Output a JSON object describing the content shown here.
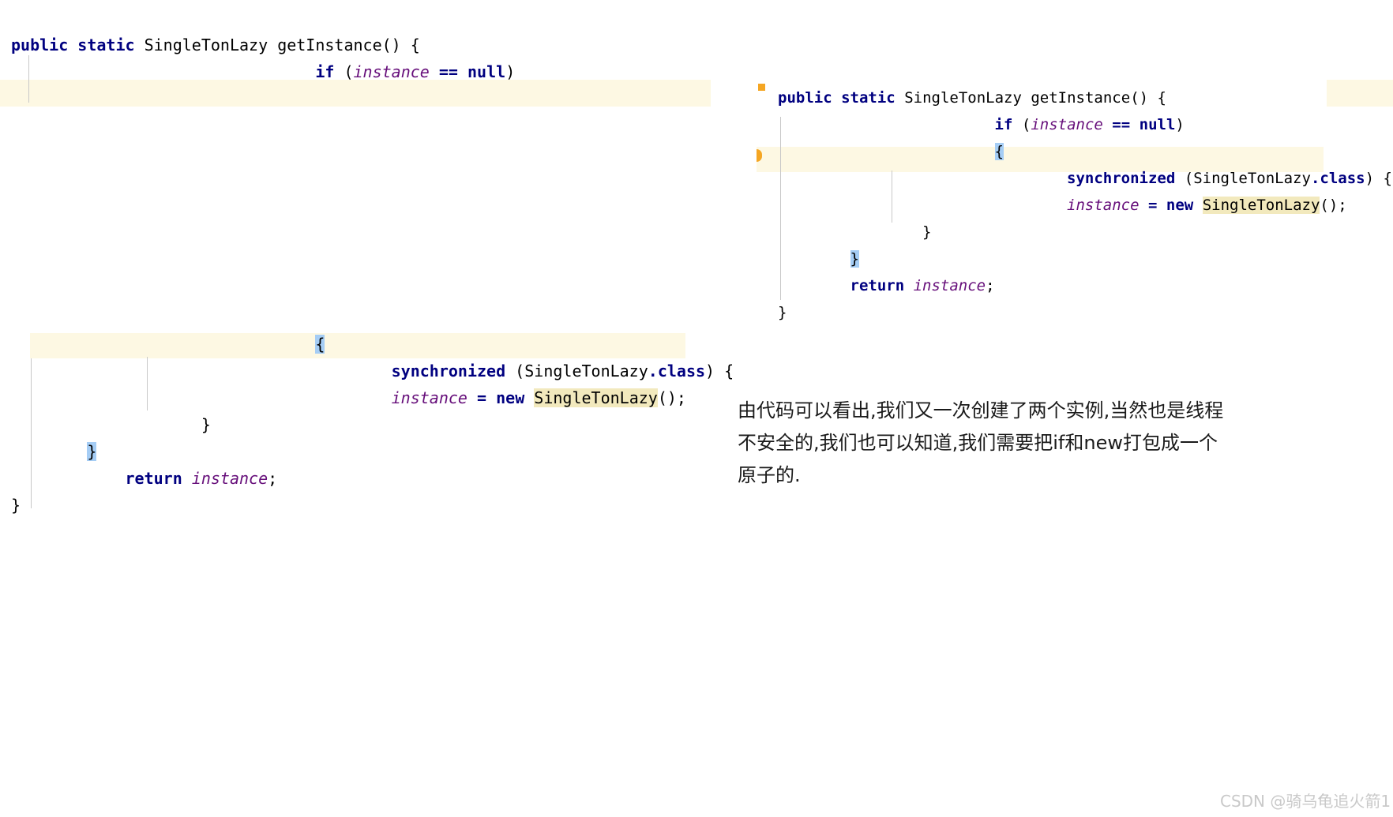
{
  "snippet_top_left": {
    "name": "getInstance-fragment-top",
    "lines": [
      {
        "indent": 0,
        "tokens": [
          {
            "text": "public",
            "style": "kw"
          },
          {
            "text": " ",
            "style": "punct"
          },
          {
            "text": "static",
            "style": "kw"
          },
          {
            "text": " ",
            "style": "punct"
          },
          {
            "text": "SingleTonLazy",
            "style": "type"
          },
          {
            "text": " ",
            "style": "punct"
          },
          {
            "text": "getInstance",
            "style": "ident"
          },
          {
            "text": "() {",
            "style": "punct"
          }
        ]
      },
      {
        "indent": 8,
        "tokens": [
          {
            "text": "if",
            "style": "kw"
          },
          {
            "text": " (",
            "style": "punct"
          },
          {
            "text": "instance",
            "style": "field"
          },
          {
            "text": " ",
            "style": "punct"
          },
          {
            "text": "==",
            "style": "op"
          },
          {
            "text": " ",
            "style": "punct"
          },
          {
            "text": "null",
            "style": "kw"
          },
          {
            "text": ")",
            "style": "punct"
          }
        ]
      }
    ]
  },
  "snippet_bottom_left": {
    "name": "getInstance-fragment-bottom",
    "lines": [
      {
        "indent": 8,
        "tokens": [
          {
            "text": "{",
            "style": "punct",
            "hl": "brace-hl"
          }
        ]
      },
      {
        "indent": 10,
        "tokens": [
          {
            "text": "synchronized",
            "style": "kw"
          },
          {
            "text": " (",
            "style": "punct"
          },
          {
            "text": "SingleTonLazy",
            "style": "classref"
          },
          {
            "text": ".class",
            "style": "dotclass"
          },
          {
            "text": ") {",
            "style": "punct"
          }
        ]
      },
      {
        "indent": 10,
        "tokens": [
          {
            "text": "instance",
            "style": "field"
          },
          {
            "text": " ",
            "style": "punct"
          },
          {
            "text": "=",
            "style": "op"
          },
          {
            "text": " ",
            "style": "punct"
          },
          {
            "text": "new",
            "style": "kw"
          },
          {
            "text": " ",
            "style": "punct"
          },
          {
            "text": "SingleTonLazy",
            "style": "classref",
            "hl": "word-hl"
          },
          {
            "text": "();",
            "style": "punct"
          }
        ]
      },
      {
        "indent": 5,
        "tokens": [
          {
            "text": "}",
            "style": "punct"
          }
        ]
      },
      {
        "indent": 2,
        "tokens": [
          {
            "text": "}",
            "style": "punct",
            "hl": "brace-hl"
          }
        ]
      },
      {
        "indent": 3,
        "tokens": [
          {
            "text": "return",
            "style": "kw"
          },
          {
            "text": " ",
            "style": "punct"
          },
          {
            "text": "instance",
            "style": "field"
          },
          {
            "text": ";",
            "style": "punct"
          }
        ]
      },
      {
        "indent": 0,
        "tokens": [
          {
            "text": "}",
            "style": "punct"
          }
        ]
      }
    ]
  },
  "snippet_right": {
    "name": "getInstance-full",
    "lines": [
      {
        "indent": 0,
        "tokens": [
          {
            "text": "public",
            "style": "kw"
          },
          {
            "text": " ",
            "style": "punct"
          },
          {
            "text": "static",
            "style": "kw"
          },
          {
            "text": " ",
            "style": "punct"
          },
          {
            "text": "SingleTonLazy",
            "style": "type"
          },
          {
            "text": " ",
            "style": "punct"
          },
          {
            "text": "getInstance",
            "style": "ident"
          },
          {
            "text": "() {",
            "style": "punct"
          }
        ]
      },
      {
        "indent": 6,
        "tokens": [
          {
            "text": "if",
            "style": "kw"
          },
          {
            "text": " (",
            "style": "punct"
          },
          {
            "text": "instance",
            "style": "field"
          },
          {
            "text": " ",
            "style": "punct"
          },
          {
            "text": "==",
            "style": "op"
          },
          {
            "text": " ",
            "style": "punct"
          },
          {
            "text": "null",
            "style": "kw"
          },
          {
            "text": ")",
            "style": "punct"
          }
        ]
      },
      {
        "indent": 6,
        "tokens": [
          {
            "text": "{",
            "style": "punct",
            "hl": "brace-hl"
          }
        ]
      },
      {
        "indent": 8,
        "tokens": [
          {
            "text": "synchronized",
            "style": "kw"
          },
          {
            "text": " (",
            "style": "punct"
          },
          {
            "text": "SingleTonLazy",
            "style": "classref"
          },
          {
            "text": ".class",
            "style": "dotclass"
          },
          {
            "text": ") {",
            "style": "punct"
          }
        ]
      },
      {
        "indent": 8,
        "tokens": [
          {
            "text": "instance",
            "style": "field"
          },
          {
            "text": " ",
            "style": "punct"
          },
          {
            "text": "=",
            "style": "op"
          },
          {
            "text": " ",
            "style": "punct"
          },
          {
            "text": "new",
            "style": "kw"
          },
          {
            "text": " ",
            "style": "punct"
          },
          {
            "text": "SingleTonLazy",
            "style": "classref",
            "hl": "word-hl"
          },
          {
            "text": "();",
            "style": "punct"
          }
        ]
      },
      {
        "indent": 4,
        "tokens": [
          {
            "text": "}",
            "style": "punct"
          }
        ]
      },
      {
        "indent": 2,
        "tokens": [
          {
            "text": "}",
            "style": "punct",
            "hl": "brace-hl"
          }
        ]
      },
      {
        "indent": 2,
        "tokens": [
          {
            "text": "return",
            "style": "kw"
          },
          {
            "text": " ",
            "style": "punct"
          },
          {
            "text": "instance",
            "style": "field"
          },
          {
            "text": ";",
            "style": "punct"
          }
        ]
      },
      {
        "indent": 0,
        "tokens": [
          {
            "text": "}",
            "style": "punct"
          }
        ]
      }
    ]
  },
  "prose": {
    "text": "由代码可以看出,我们又一次创建了两个实例,当然也是线程\n不安全的,我们也可以知道,我们需要把if和new打包成一个\n原子的."
  },
  "watermark": {
    "text": "CSDN @骑乌龟追火箭1"
  },
  "colors": {
    "keyword": "#000080",
    "field": "#660e7a",
    "brace_highlight": "#a5cdf5",
    "word_highlight": "#f2e9bd",
    "caret_band": "#fdf8e3",
    "gutter_marker": "#f5a623",
    "indent_guide": "#c8c8c8",
    "watermark": "#c9c9c9"
  }
}
